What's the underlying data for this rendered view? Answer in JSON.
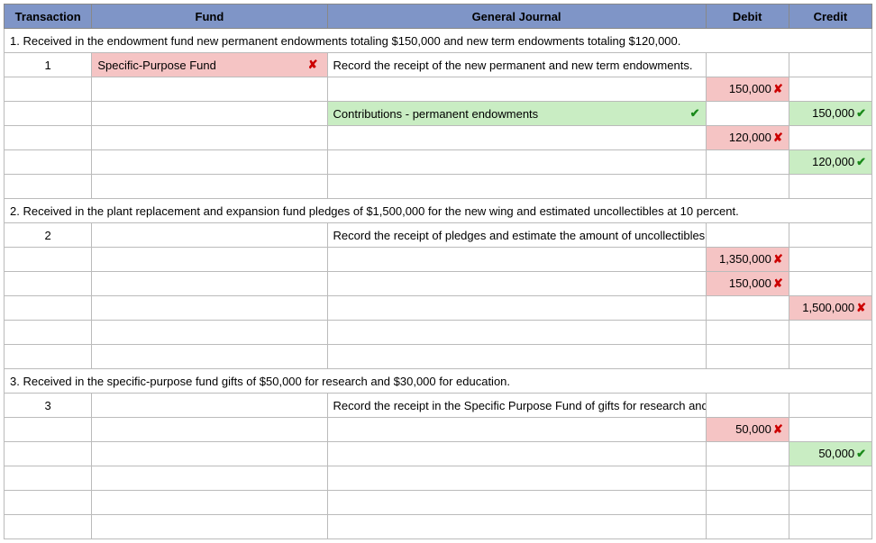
{
  "headers": {
    "transaction": "Transaction",
    "fund": "Fund",
    "gj": "General Journal",
    "debit": "Debit",
    "credit": "Credit"
  },
  "t1": {
    "desc": "1. Received in the endowment fund new permanent endowments totaling $150,000 and new term endowments totaling $120,000.",
    "num": "1",
    "fund": "Specific-Purpose Fund",
    "gj_instr": "Record the receipt of the new permanent and new term endowments.",
    "line2_gj": "Contributions - permanent endowments",
    "debit1": "150,000",
    "credit1": "150,000",
    "debit2": "120,000",
    "credit2": "120,000"
  },
  "t2": {
    "desc": "2. Received in the plant replacement and expansion fund pledges of $1,500,000 for the new wing and estimated uncollectibles at 10 percent.",
    "num": "2",
    "gj_instr": "Record the receipt of pledges and estimate the amount of uncollectibles for the new wing.",
    "debit1": "1,350,000",
    "debit2": "150,000",
    "credit1": "1,500,000"
  },
  "t3": {
    "desc": "3. Received in the specific-purpose fund gifts of $50,000 for research and $30,000 for education.",
    "num": "3",
    "gj_instr": "Record the receipt in the Specific Purpose Fund of gifts for research and education.",
    "debit1": "50,000",
    "credit1": "50,000"
  }
}
